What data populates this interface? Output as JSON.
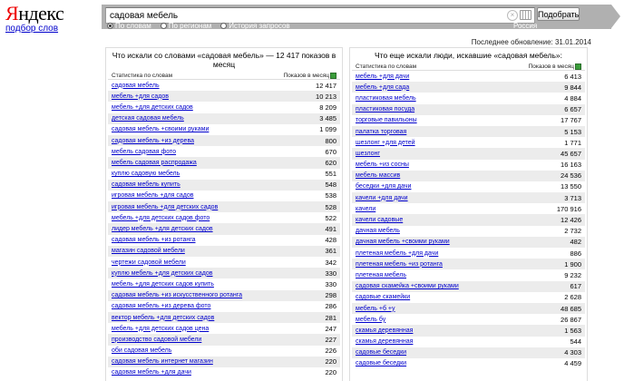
{
  "logo": {
    "first": "Я",
    "rest": "ндекс"
  },
  "subtitle_link": "подбор слов",
  "search": {
    "value": "садовая мебель",
    "submit_label": "Подобрать"
  },
  "modes": [
    "По словам",
    "По регионам",
    "История запросов"
  ],
  "selected_mode": "По словам",
  "region": "Россия",
  "updated": "Последнее обновление: 31.01.2014",
  "left": {
    "title": "Что искали со словами «садовая мебель» — 12 417 показов в месяц",
    "col_stats": "Статистика по словам",
    "col_count": "Показов в месяц",
    "rows": [
      {
        "q": "садовая мебель",
        "n": "12 417"
      },
      {
        "q": "мебель +для садов",
        "n": "10 213"
      },
      {
        "q": "мебель +для детских садов",
        "n": "8 209"
      },
      {
        "q": "детская садовая мебель",
        "n": "3 485"
      },
      {
        "q": "садовая мебель +своими руками",
        "n": "1 099"
      },
      {
        "q": "садовая мебель +из дерева",
        "n": "800"
      },
      {
        "q": "мебель садовая фото",
        "n": "670"
      },
      {
        "q": "мебель садовая распродажа",
        "n": "620"
      },
      {
        "q": "куплю садовую мебель",
        "n": "551"
      },
      {
        "q": "садовая мебель купить",
        "n": "548"
      },
      {
        "q": "игровая мебель +для садов",
        "n": "538"
      },
      {
        "q": "игровая мебель +для детских садов",
        "n": "528"
      },
      {
        "q": "мебель +для детских садов фото",
        "n": "522"
      },
      {
        "q": "лидер мебель +для детских садов",
        "n": "491"
      },
      {
        "q": "садовая мебель +из ротанга",
        "n": "428"
      },
      {
        "q": "магазин садовой мебели",
        "n": "361"
      },
      {
        "q": "чертежи садовой мебели",
        "n": "342"
      },
      {
        "q": "куплю мебель +для детских садов",
        "n": "330"
      },
      {
        "q": "мебель +для детских садов купить",
        "n": "330"
      },
      {
        "q": "садовая мебель +из искусственного ротанга",
        "n": "298"
      },
      {
        "q": "садовая мебель +из дерева фото",
        "n": "286"
      },
      {
        "q": "вектор мебель +для детских садов",
        "n": "281"
      },
      {
        "q": "мебель +для детских садов цена",
        "n": "247"
      },
      {
        "q": "производство садовой мебели",
        "n": "227"
      },
      {
        "q": "оби садовая мебель",
        "n": "226"
      },
      {
        "q": "садовая мебель интернет магазин",
        "n": "220"
      },
      {
        "q": "садовая мебель +для дачи",
        "n": "220"
      }
    ]
  },
  "right": {
    "title": "Что еще искали люди, искавшие «садовая мебель»:",
    "col_stats": "Статистика по словам",
    "col_count": "Показов в месяц",
    "rows": [
      {
        "q": "мебель +для дачи",
        "n": "6 413"
      },
      {
        "q": "мебель +для сада",
        "n": "9 844"
      },
      {
        "q": "пластиковая мебель",
        "n": "4 884"
      },
      {
        "q": "пластиковая посуда",
        "n": "6 657"
      },
      {
        "q": "торговые павильоны",
        "n": "17 767"
      },
      {
        "q": "палатка торговая",
        "n": "5 153"
      },
      {
        "q": "шезлонг +для детей",
        "n": "1 771"
      },
      {
        "q": "шезлонг",
        "n": "45 657"
      },
      {
        "q": "мебель +из сосны",
        "n": "16 163"
      },
      {
        "q": "мебель массив",
        "n": "24 536"
      },
      {
        "q": "беседки +для дачи",
        "n": "13 550"
      },
      {
        "q": "качели +для дачи",
        "n": "3 713"
      },
      {
        "q": "качели",
        "n": "170 916"
      },
      {
        "q": "качели садовые",
        "n": "12 426"
      },
      {
        "q": "дачная мебель",
        "n": "2 732"
      },
      {
        "q": "дачная мебель +своими руками",
        "n": "482"
      },
      {
        "q": "плетеная мебель +для дачи",
        "n": "886"
      },
      {
        "q": "плетеная мебель +из ротанга",
        "n": "1 900"
      },
      {
        "q": "плетеная мебель",
        "n": "9 232"
      },
      {
        "q": "садовая скамейка +своими руками",
        "n": "617"
      },
      {
        "q": "садовые скамейки",
        "n": "2 628"
      },
      {
        "q": "мебель +б +у",
        "n": "48 685"
      },
      {
        "q": "мебель бу",
        "n": "26 867"
      },
      {
        "q": "скамья деревянная",
        "n": "1 563"
      },
      {
        "q": "скамья деревянная",
        "n": "544"
      },
      {
        "q": "садовые беседки",
        "n": "4 303"
      },
      {
        "q": "садовые беседки",
        "n": "4 459"
      }
    ]
  }
}
